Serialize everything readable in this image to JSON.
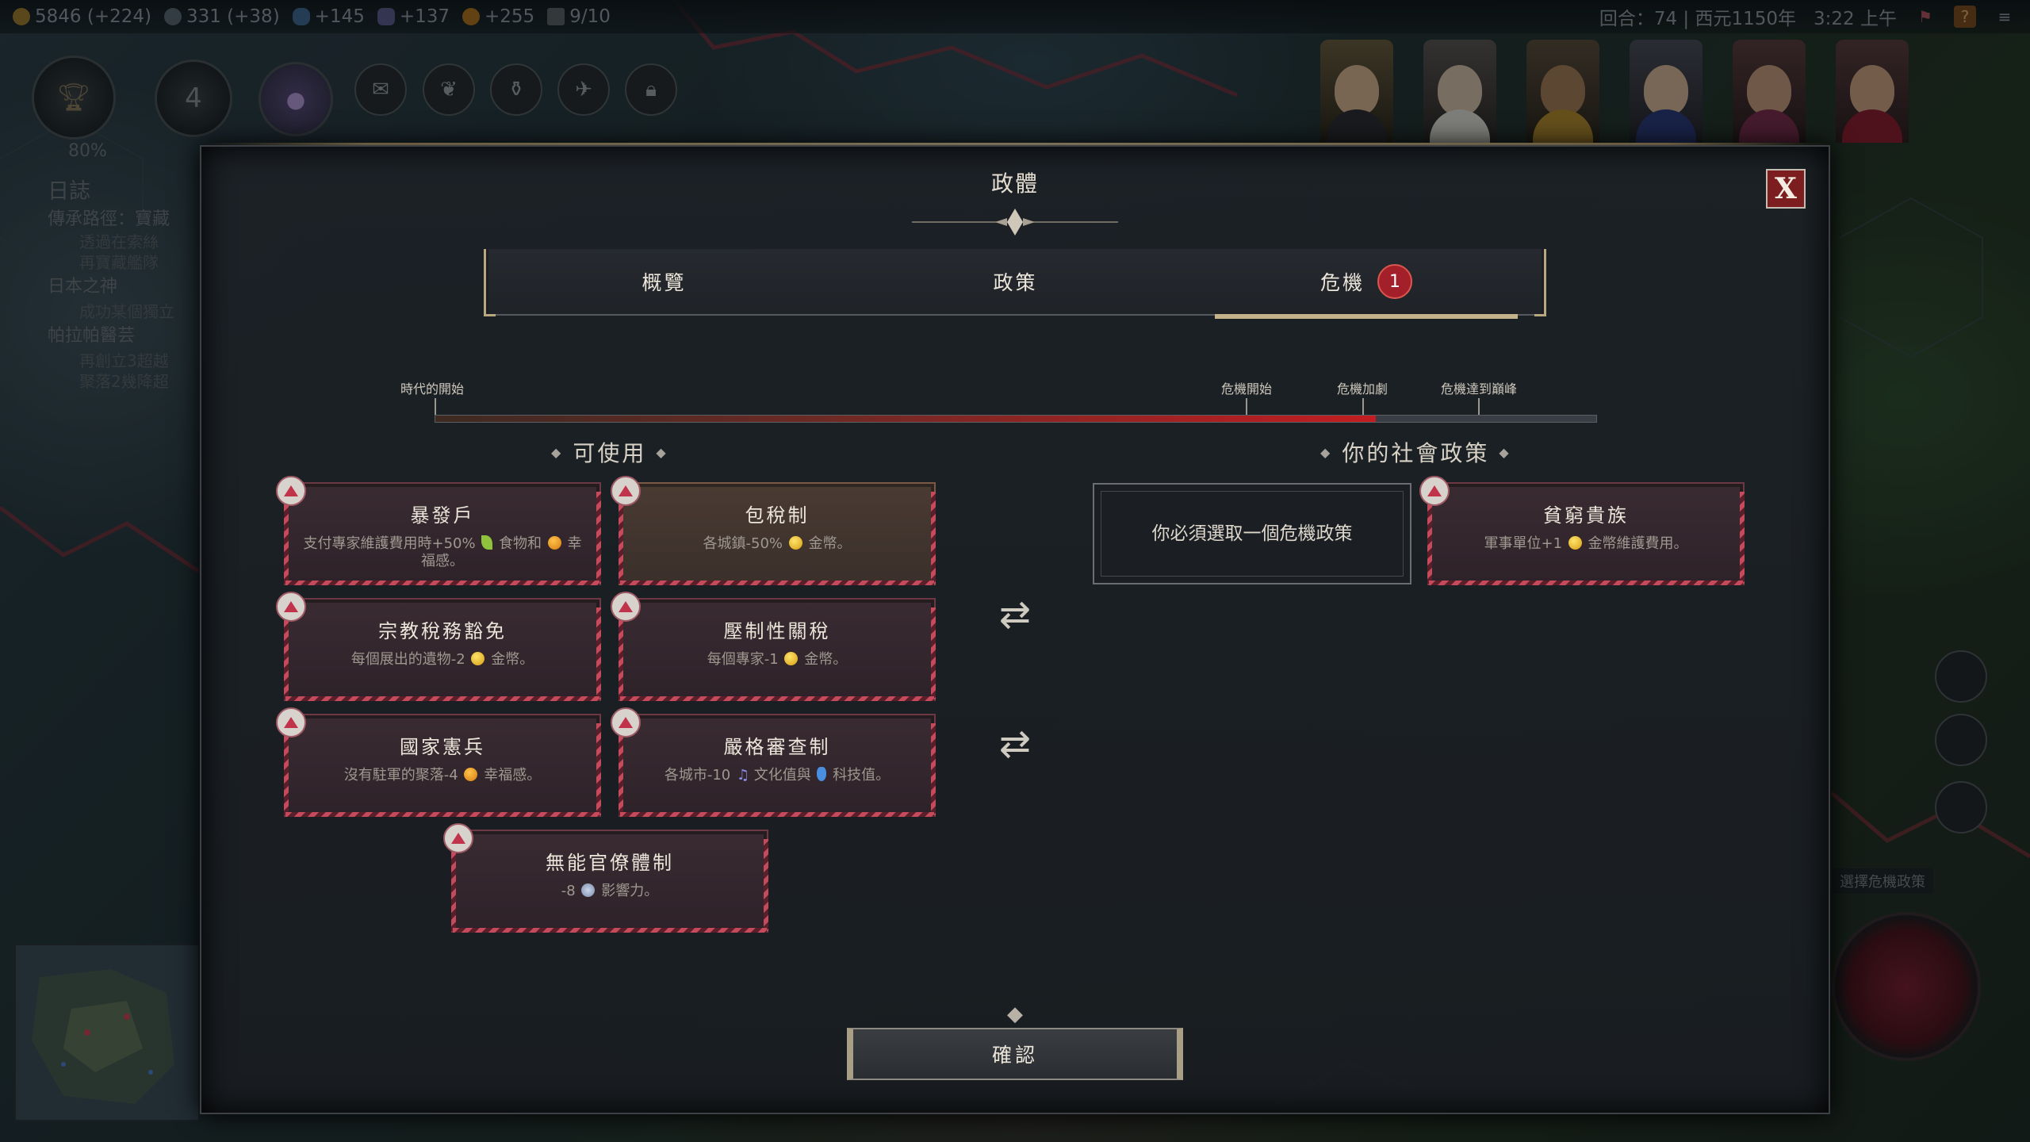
{
  "hud": {
    "gold": "5846 (+224)",
    "influence": "331 (+38)",
    "science": "+145",
    "culture": "+137",
    "happiness": "+255",
    "city_count": "9/10",
    "turn_text": "回合：74 | 西元1150年",
    "clock": "3:22 上午",
    "progress_percent": "80%",
    "partial_number": "4"
  },
  "log": {
    "title": "日誌",
    "lines": [
      "傳承路徑：寶藏",
      "透過在索絲",
      "再寶藏艦隊",
      "日本之神",
      "成功某個獨立",
      "帕拉帕醫芸",
      "再創立3超越",
      "聚落2幾降超"
    ]
  },
  "modal": {
    "title": "政體",
    "close_label": "X",
    "tabs": [
      {
        "label": "概覽"
      },
      {
        "label": "政策"
      },
      {
        "label": "危機",
        "badge": "1"
      }
    ],
    "active_tab": 2,
    "timeline": {
      "start_label": "時代的開始",
      "markers": [
        "危機開始",
        "危機加劇",
        "危機達到巔峰"
      ],
      "progress": 0.81
    },
    "available_header": "可使用",
    "social_header": "你的社會政策",
    "available_policies": [
      {
        "name": "暴發戶",
        "desc_a": "支付專家維護費用時+50%",
        "desc_b": "食物和",
        "desc_c": "幸福感。"
      },
      {
        "name": "包稅制",
        "desc_a": "各城鎮-50%",
        "desc_b": "金幣。"
      },
      {
        "name": "宗教稅務豁免",
        "desc_a": "每個展出的遺物-2",
        "desc_b": "金幣。"
      },
      {
        "name": "壓制性關稅",
        "desc_a": "每個專家-1",
        "desc_b": "金幣。"
      },
      {
        "name": "國家憲兵",
        "desc_a": "沒有駐軍的聚落-4",
        "desc_b": "幸福感。"
      },
      {
        "name": "嚴格審查制",
        "desc_a": "各城市-10",
        "desc_b": "文化值與",
        "desc_c": "科技值。"
      },
      {
        "name": "無能官僚體制",
        "desc_a": "-8",
        "desc_b": "影響力。"
      }
    ],
    "empty_slot_text": "你必須選取一個危機政策",
    "social_policies": [
      {
        "name": "貧窮貴族",
        "desc_a": "軍事單位+1",
        "desc_b": "金幣維護費用。"
      }
    ],
    "confirm_label": "確認"
  },
  "right_panel": {
    "crisis_tooltip": "選擇危機政策"
  },
  "colors": {
    "crisis_red": "#c21d22",
    "card_border": "#6b3843",
    "close_bg": "#7c1d1f",
    "accent_gold": "#c4b28a"
  }
}
